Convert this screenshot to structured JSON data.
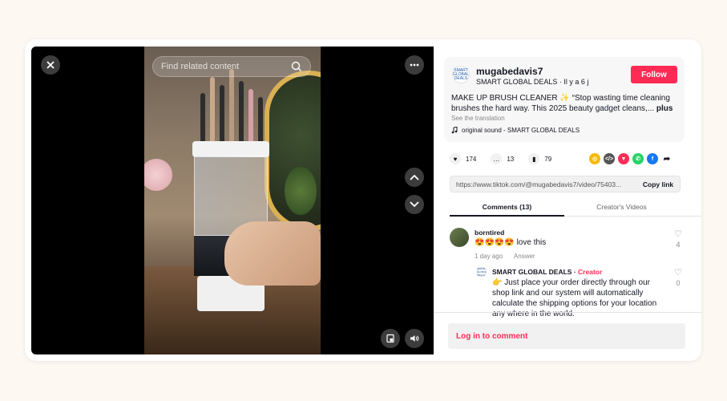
{
  "search": {
    "placeholder": "Find related content"
  },
  "author": {
    "avatar_text": "SMART GLOBAL DEALS",
    "username": "mugabedavis7",
    "nickname": "SMART GLOBAL DEALS",
    "separator": " · ",
    "posted": "Il y a 6 j",
    "follow_label": "Follow"
  },
  "post": {
    "description": "MAKE UP BRUSH CLEANER ✨ “Stop wasting time cleaning brushes the hard way. This 2025 beauty gadget cleans,...",
    "more_label": "plus",
    "translate_label": "See the translation",
    "sound": "original sound - SMART GLOBAL DEALS"
  },
  "actions": {
    "likes": "174",
    "comments": "13",
    "saves": "79"
  },
  "share_icons": [
    "embed-icon",
    "code-icon",
    "repost-icon",
    "whatsapp-icon",
    "facebook-icon",
    "share-arrow-icon"
  ],
  "link": {
    "url": "https://www.tiktok.com/@mugabedavis7/video/75403...",
    "copy_label": "Copy link"
  },
  "tabs": {
    "comments": "Comments (13)",
    "creator_videos": "Creator's Videos"
  },
  "comments": [
    {
      "user": "borntired",
      "text": "😍😍😍😍 love this",
      "time": "1 day ago",
      "reply_label": "Answer",
      "likes": "4"
    }
  ],
  "reply": {
    "user": "SMART GLOBAL DEALS",
    "separator": " · ",
    "badge": "Creator",
    "text": "👉 Just place your order directly through our shop link and our system will automatically calculate the shipping options for your location any where in the world.",
    "likes": "0"
  },
  "login_label": "Log in to comment",
  "colors": {
    "accent": "#fe2c55",
    "background": "#fdf8f2"
  }
}
